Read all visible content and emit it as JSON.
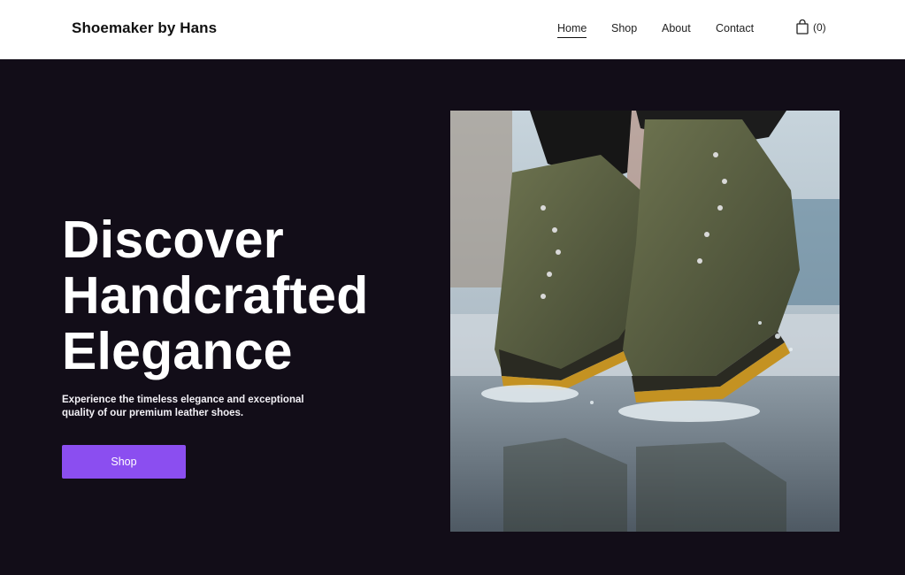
{
  "header": {
    "brand": "Shoemaker by Hans",
    "nav": [
      {
        "label": "Home",
        "active": true
      },
      {
        "label": "Shop",
        "active": false
      },
      {
        "label": "About",
        "active": false
      },
      {
        "label": "Contact",
        "active": false
      }
    ],
    "cart": {
      "icon": "shopping-bag-icon",
      "count_text": "(0)"
    }
  },
  "hero": {
    "headline_lines": [
      "Discover",
      "Handcrafted",
      "Elegance"
    ],
    "subtext": "Experience the timeless elegance and exceptional quality of our premium leather shoes.",
    "cta_label": "Shop",
    "image": {
      "subject": "olive sneakers splashing in a puddle"
    }
  },
  "colors": {
    "hero_background": "#120d18",
    "accent": "#8b4ef0",
    "header_background": "#ffffff",
    "text_dark": "#111111",
    "text_light": "#ffffff"
  }
}
